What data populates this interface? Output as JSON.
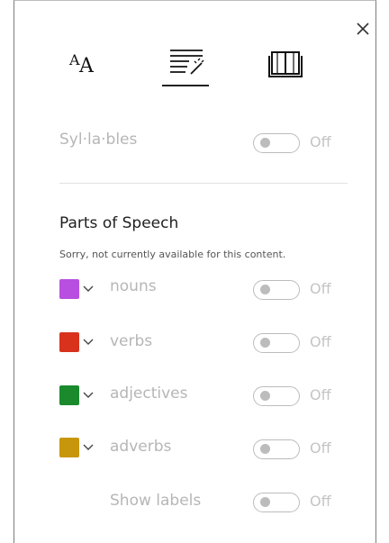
{
  "panel": {
    "tabs": [
      {
        "name": "text-preferences",
        "icon": "text-size-icon"
      },
      {
        "name": "grammar-options",
        "icon": "grammar-options-icon",
        "selected": true
      },
      {
        "name": "reading-preferences",
        "icon": "book-icon"
      }
    ]
  },
  "syllables": {
    "label": "Syl·la·bles",
    "state": "Off"
  },
  "parts_of_speech": {
    "title": "Parts of Speech",
    "note": "Sorry, not currently available for this content.",
    "items": [
      {
        "label": "nouns",
        "color": "#b84fe0",
        "state": "Off"
      },
      {
        "label": "verbs",
        "color": "#d8321d",
        "state": "Off"
      },
      {
        "label": "adjectives",
        "color": "#1a8a2d",
        "state": "Off"
      },
      {
        "label": "adverbs",
        "color": "#c8960a",
        "state": "Off"
      }
    ],
    "show_labels": {
      "label": "Show labels",
      "state": "Off"
    }
  },
  "colors": {
    "disabled_text": "#b6b6b6",
    "toggle_off": "#bcbcbc",
    "title_text": "#1f1f1f"
  }
}
